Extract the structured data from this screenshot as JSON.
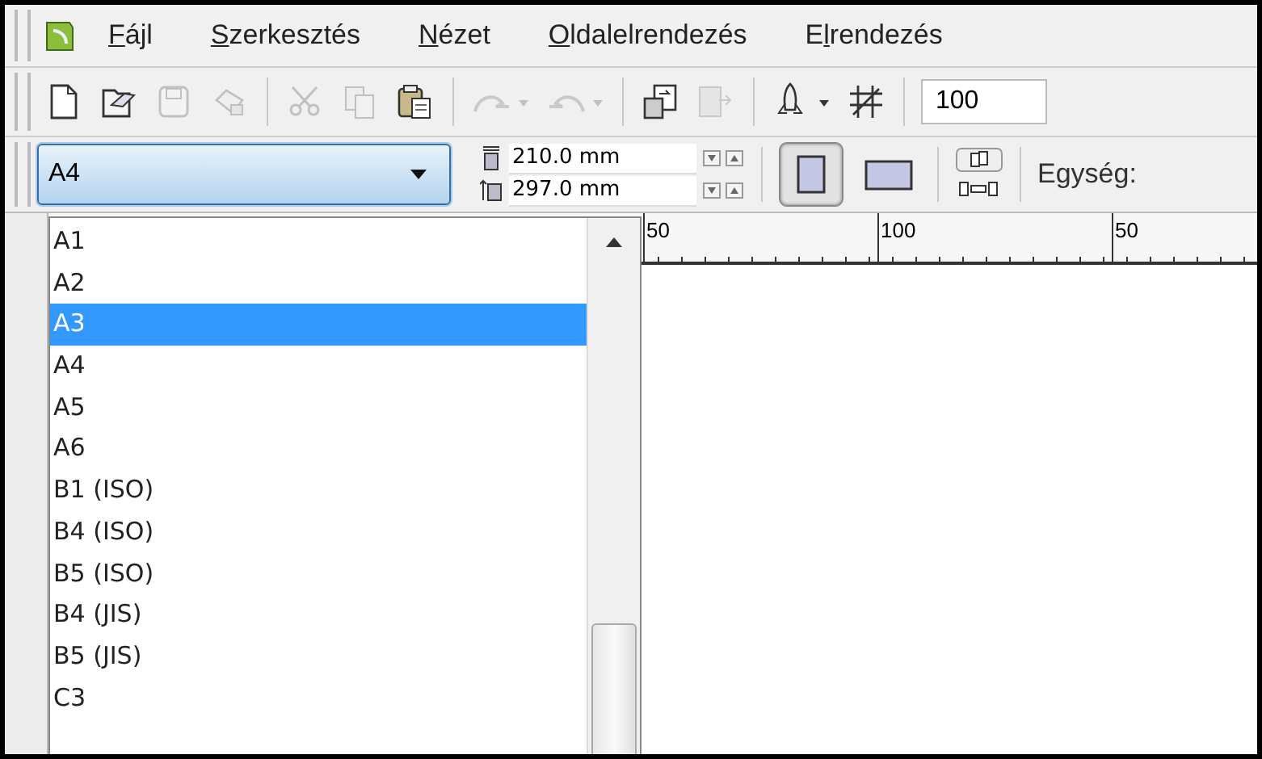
{
  "menu": [
    {
      "key": "F",
      "post": "ájl"
    },
    {
      "key": "S",
      "post": "zerkesztés"
    },
    {
      "key": "N",
      "post": "ézet"
    },
    {
      "key": "O",
      "post": "ldalelrendezés"
    },
    {
      "pre": "E",
      "key": "l",
      "post": "rendezés"
    }
  ],
  "toolbar": [
    {
      "kind": "new",
      "disabled": false
    },
    {
      "kind": "open",
      "disabled": false
    },
    {
      "kind": "save",
      "disabled": true
    },
    {
      "kind": "print",
      "disabled": true
    },
    {
      "kind": "sep"
    },
    {
      "kind": "cut",
      "disabled": true
    },
    {
      "kind": "copy",
      "disabled": true
    },
    {
      "kind": "paste",
      "disabled": false
    },
    {
      "kind": "sep"
    },
    {
      "kind": "undo",
      "disabled": true
    },
    {
      "kind": "redo",
      "disabled": true
    },
    {
      "kind": "sep"
    },
    {
      "kind": "import",
      "disabled": false
    },
    {
      "kind": "export",
      "disabled": true
    },
    {
      "kind": "sep"
    },
    {
      "kind": "launch",
      "disabled": false
    },
    {
      "kind": "snap",
      "disabled": false
    },
    {
      "kind": "sep"
    }
  ],
  "zoom_field": {
    "value": "100"
  },
  "property_bar": {
    "page_size": {
      "value": "A4",
      "expanded": true
    },
    "width": {
      "value": "210.0 mm"
    },
    "height": {
      "value": "297.0 mm"
    },
    "orientation": [
      {
        "kind": "portrait",
        "selected": true
      },
      {
        "kind": "landscape",
        "selected": false
      }
    ],
    "unit_label": "Egység:"
  },
  "page_size_list": [
    {
      "label": "A1",
      "selected": false
    },
    {
      "label": "A2",
      "selected": false
    },
    {
      "label": "A3",
      "selected": true
    },
    {
      "label": "A4",
      "selected": false
    },
    {
      "label": "A5",
      "selected": false
    },
    {
      "label": "A6",
      "selected": false
    },
    {
      "label": "B1 (ISO)",
      "selected": false
    },
    {
      "label": "B4 (ISO)",
      "selected": false
    },
    {
      "label": "B5 (ISO)",
      "selected": false
    },
    {
      "label": "B4 (JIS)",
      "selected": false
    },
    {
      "label": "B5 (JIS)",
      "selected": false
    },
    {
      "label": "C3",
      "selected": false
    }
  ],
  "ruler": [
    "50",
    "100",
    "50"
  ]
}
